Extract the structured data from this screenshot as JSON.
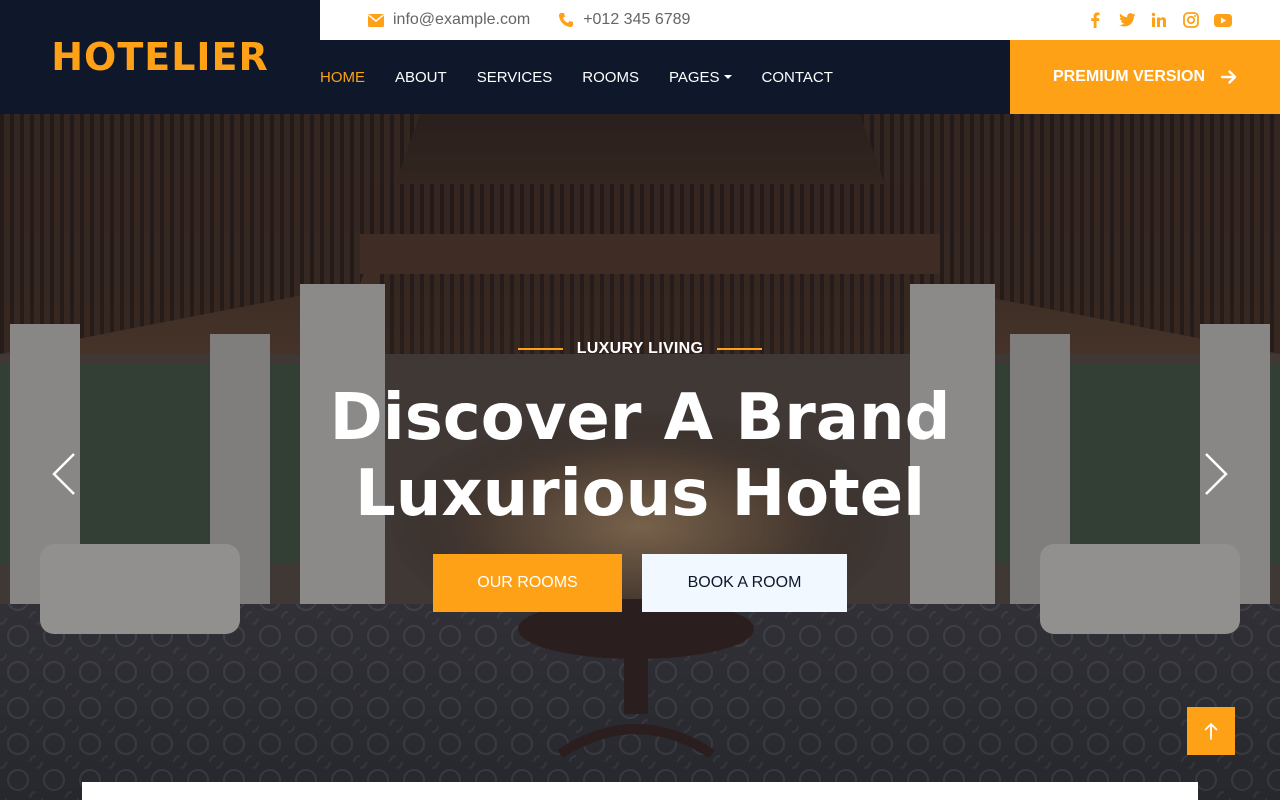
{
  "brand": {
    "name": "HOTELIER"
  },
  "topbar": {
    "email": "info@example.com",
    "phone": "+012 345 6789",
    "socials": [
      "facebook-icon",
      "twitter-icon",
      "linkedin-icon",
      "instagram-icon",
      "youtube-icon"
    ]
  },
  "nav": {
    "items": [
      {
        "label": "HOME",
        "active": true
      },
      {
        "label": "ABOUT"
      },
      {
        "label": "SERVICES"
      },
      {
        "label": "ROOMS"
      },
      {
        "label": "PAGES",
        "dropdown": true
      },
      {
        "label": "CONTACT"
      }
    ],
    "premium_label": "PREMIUM VERSION"
  },
  "hero": {
    "subtitle": "LUXURY LIVING",
    "headline_line1": "Discover A Brand",
    "headline_line2": "Luxurious Hotel",
    "primary_button": "OUR ROOMS",
    "secondary_button": "BOOK A ROOM"
  },
  "colors": {
    "accent": "#fea116",
    "dark": "#0f172b",
    "light_button": "#f1f8ff"
  }
}
